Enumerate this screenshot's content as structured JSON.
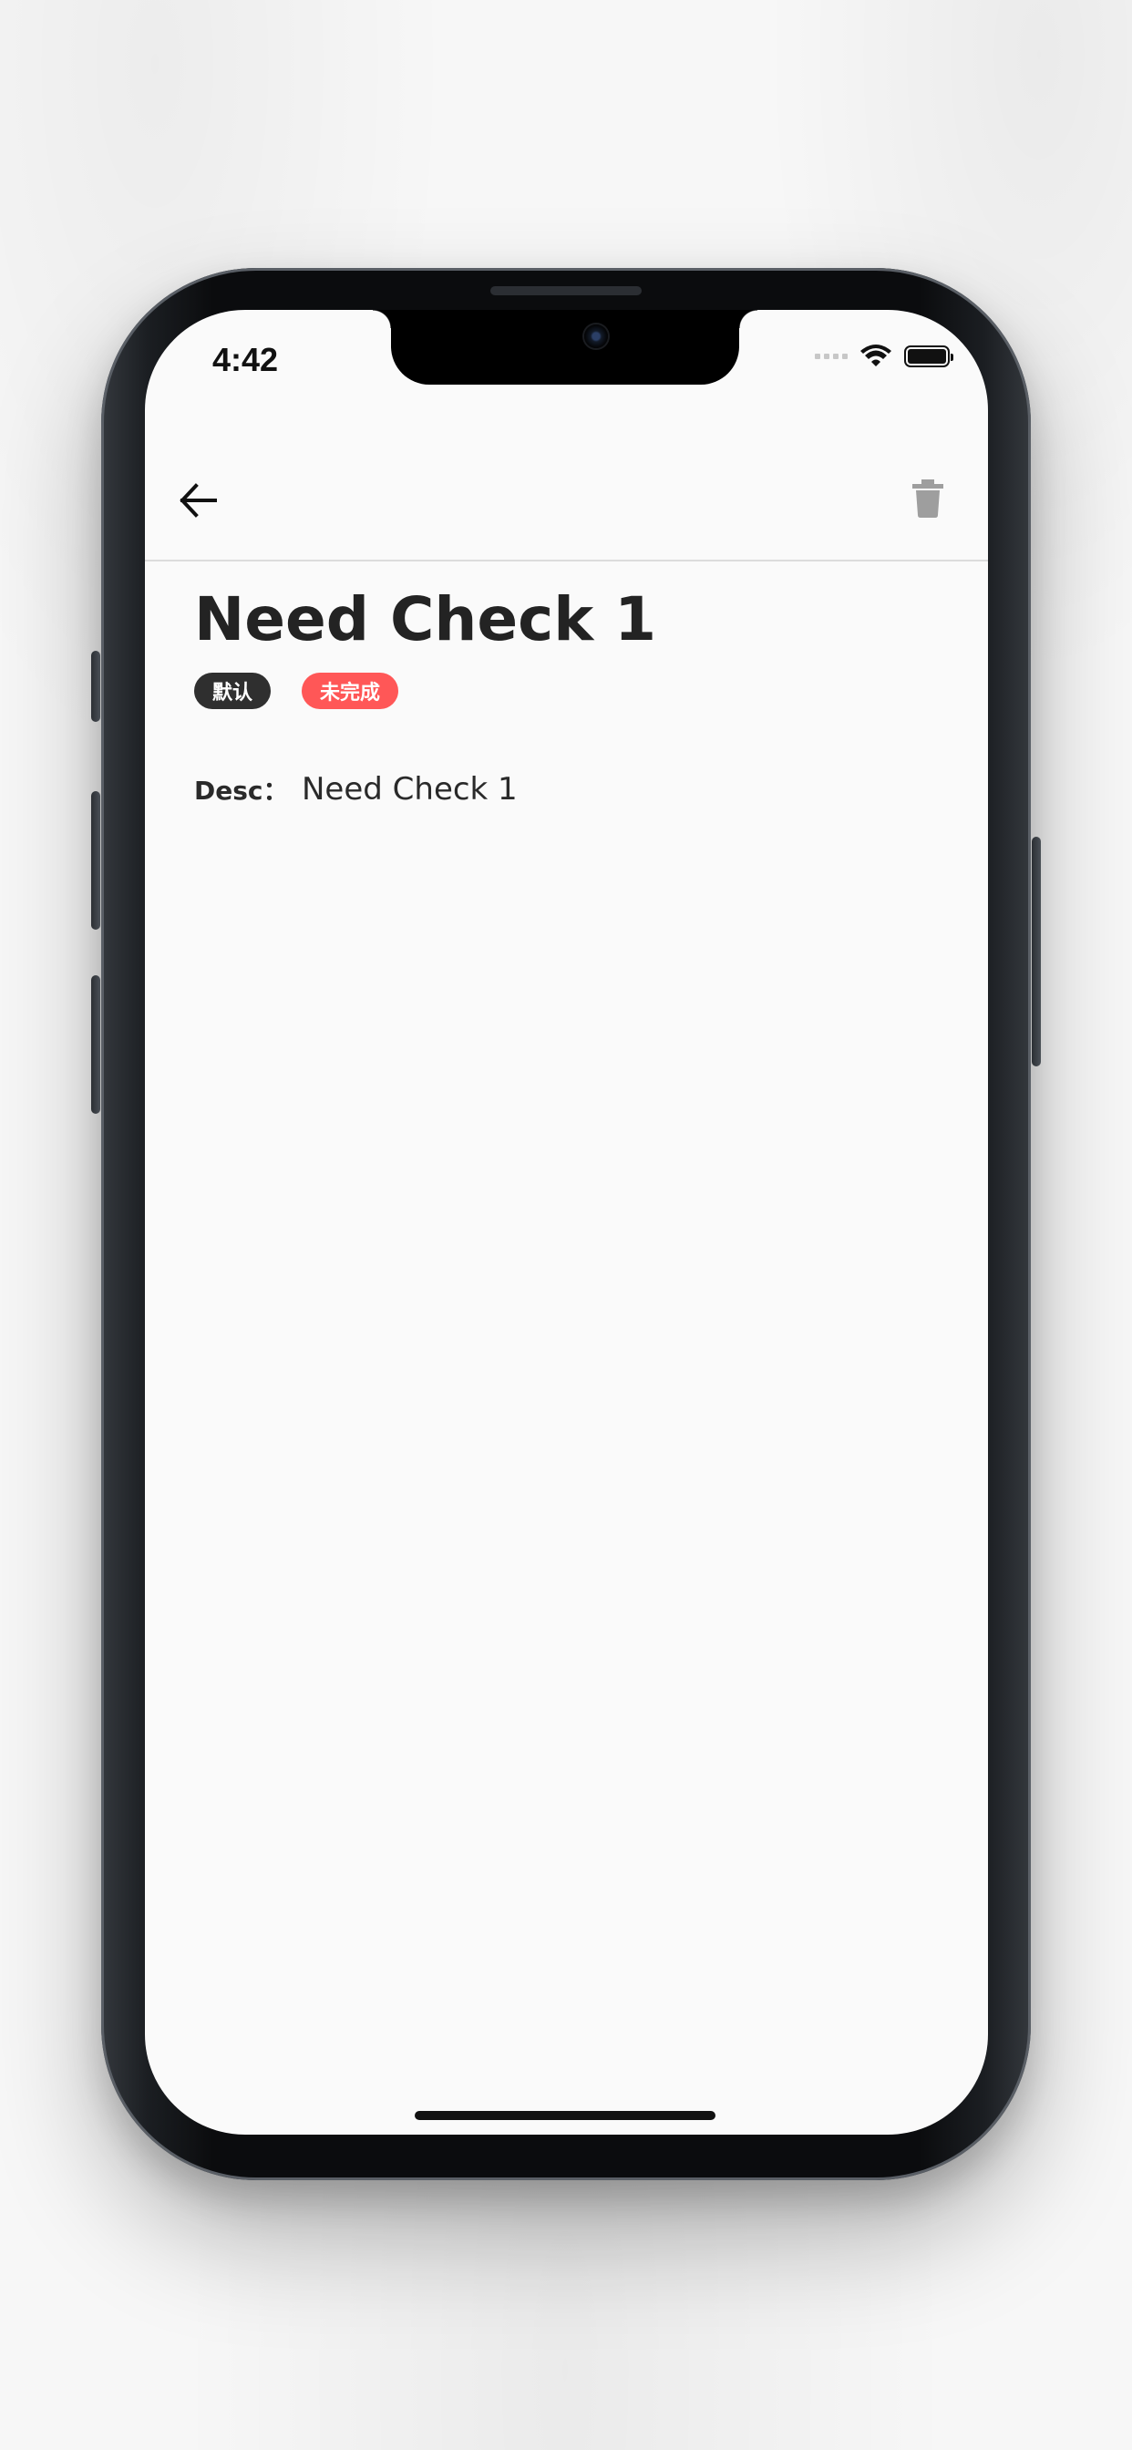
{
  "status_bar": {
    "time": "4:42"
  },
  "appbar": {
    "back_icon": "arrow-left-icon",
    "delete_icon": "trash-icon"
  },
  "todo": {
    "title": "Need Check 1",
    "tags": [
      "默认",
      "未完成"
    ],
    "desc_label": "Desc：",
    "desc_value": "Need Check 1"
  },
  "colors": {
    "tag_default": "#2f2f2f",
    "tag_incomplete": "#ff5757",
    "screen_bg": "#fafafa"
  }
}
